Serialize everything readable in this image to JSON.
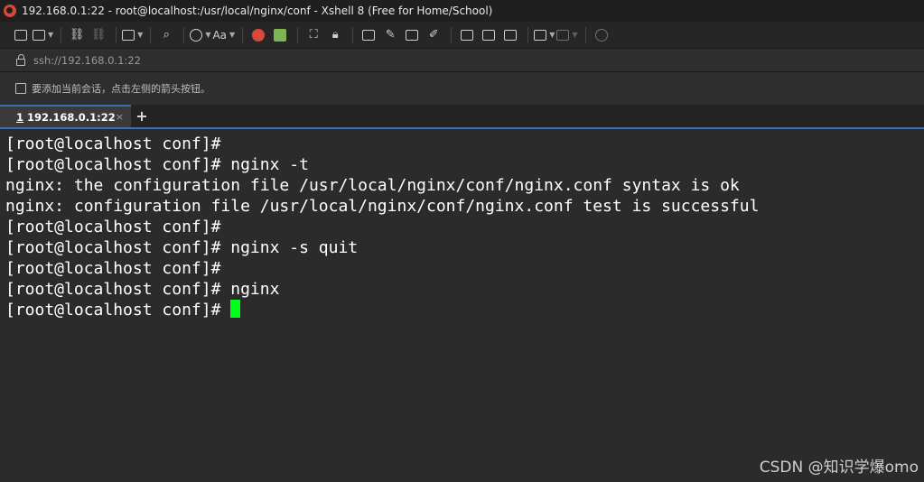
{
  "window": {
    "title": "192.168.0.1:22 - root@localhost:/usr/local/nginx/conf - Xshell 8 (Free for Home/School)"
  },
  "toolbar": {
    "font_label": "Aa"
  },
  "address": {
    "value": "ssh://192.168.0.1:22"
  },
  "hint": {
    "text": "要添加当前会话，点击左侧的箭头按钮。"
  },
  "tabs": [
    {
      "number": "1",
      "label": "192.168.0.1:22",
      "status_color": "#2fcc3c",
      "close_label": "×"
    }
  ],
  "tab_add_label": "+",
  "terminal": {
    "lines": [
      "[root@localhost conf]#",
      "[root@localhost conf]# nginx -t",
      "nginx: the configuration file /usr/local/nginx/conf/nginx.conf syntax is ok",
      "nginx: configuration file /usr/local/nginx/conf/nginx.conf test is successful",
      "[root@localhost conf]#",
      "[root@localhost conf]# nginx -s quit",
      "[root@localhost conf]#",
      "[root@localhost conf]# nginx",
      "[root@localhost conf]# "
    ],
    "cursor_color": "#00ff1a"
  },
  "watermark": "CSDN @知识学爆omo"
}
